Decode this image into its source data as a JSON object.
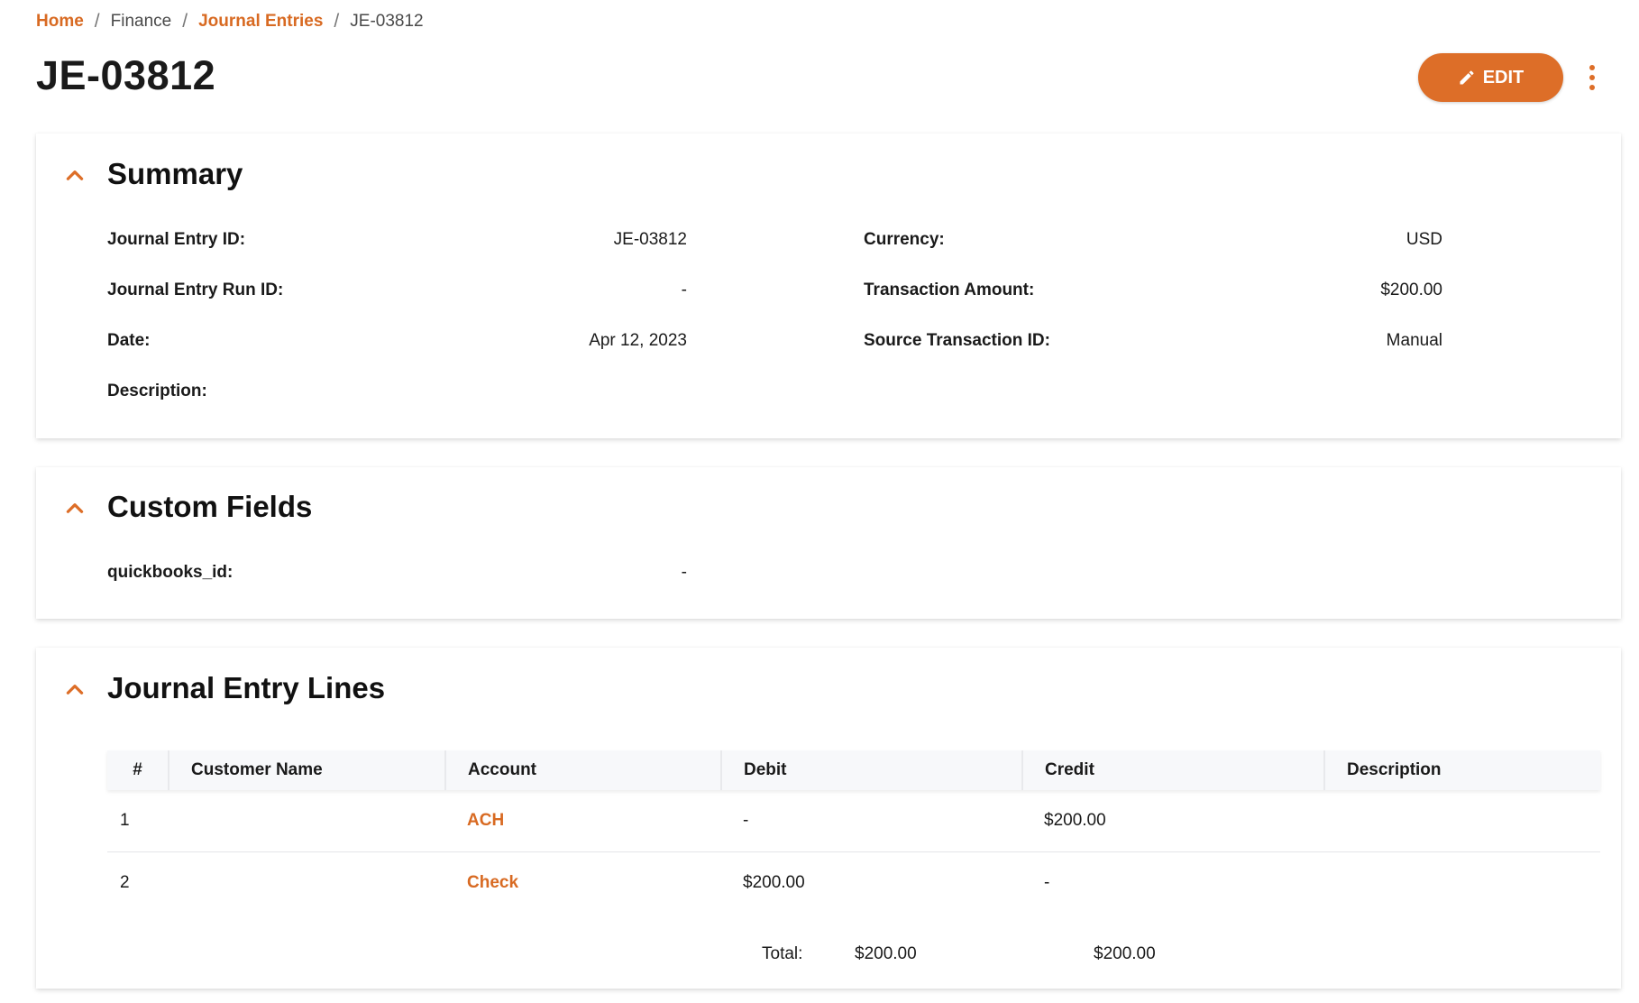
{
  "breadcrumb": {
    "home": "Home",
    "finance": "Finance",
    "journal_entries": "Journal Entries",
    "current": "JE-03812",
    "separator": "/"
  },
  "page": {
    "title": "JE-03812",
    "edit_label": "EDIT"
  },
  "summary": {
    "title": "Summary",
    "fields": {
      "je_id_label": "Journal Entry ID:",
      "je_id_value": "JE-03812",
      "run_id_label": "Journal Entry Run ID:",
      "run_id_value": "-",
      "date_label": "Date:",
      "date_value": "Apr 12, 2023",
      "description_label": "Description:",
      "currency_label": "Currency:",
      "currency_value": "USD",
      "amount_label": "Transaction Amount:",
      "amount_value": "$200.00",
      "source_label": "Source Transaction ID:",
      "source_value": "Manual"
    }
  },
  "custom_fields": {
    "title": "Custom Fields",
    "quickbooks_label": "quickbooks_id:",
    "quickbooks_value": "-"
  },
  "lines": {
    "title": "Journal Entry Lines",
    "columns": [
      "#",
      "Customer Name",
      "Account",
      "Debit",
      "Credit",
      "Description"
    ],
    "rows": [
      {
        "num": "1",
        "customer": "",
        "account": "ACH",
        "debit": "-",
        "credit": "$200.00",
        "description": ""
      },
      {
        "num": "2",
        "customer": "",
        "account": "Check",
        "debit": "$200.00",
        "credit": "-",
        "description": ""
      }
    ],
    "total_label": "Total:",
    "total_debit": "$200.00",
    "total_credit": "$200.00"
  },
  "colors": {
    "accent": "#dd6e28"
  }
}
